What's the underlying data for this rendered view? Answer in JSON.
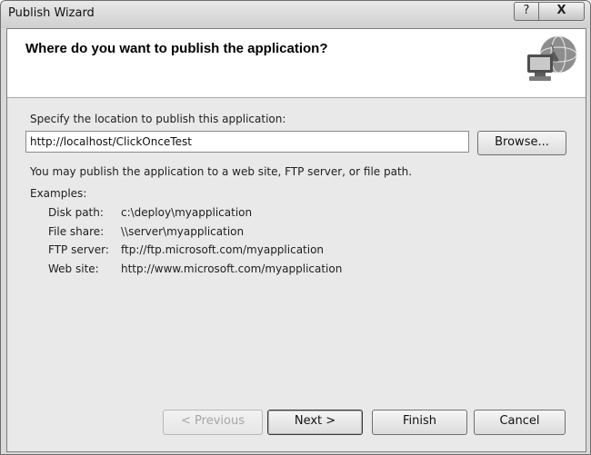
{
  "window": {
    "title": "Publish Wizard",
    "help_label": "?",
    "close_label": "X"
  },
  "header": {
    "title": "Where do you want to publish the application?",
    "icon": "globe-computer-icon"
  },
  "location": {
    "label": "Specify the location to publish this application:",
    "value": "http://localhost/ClickOnceTest",
    "browse_label": "Browse..."
  },
  "info_text": "You may publish the application to a web site, FTP server, or file path.",
  "examples": {
    "heading": "Examples:",
    "rows": [
      {
        "label": "Disk path:",
        "value": "c:\\deploy\\myapplication"
      },
      {
        "label": "File share:",
        "value": "\\\\server\\myapplication"
      },
      {
        "label": "FTP server:",
        "value": "ftp://ftp.microsoft.com/myapplication"
      },
      {
        "label": "Web site:",
        "value": "http://www.microsoft.com/myapplication"
      }
    ]
  },
  "buttons": {
    "previous": "< Previous",
    "next": "Next >",
    "finish": "Finish",
    "cancel": "Cancel"
  }
}
